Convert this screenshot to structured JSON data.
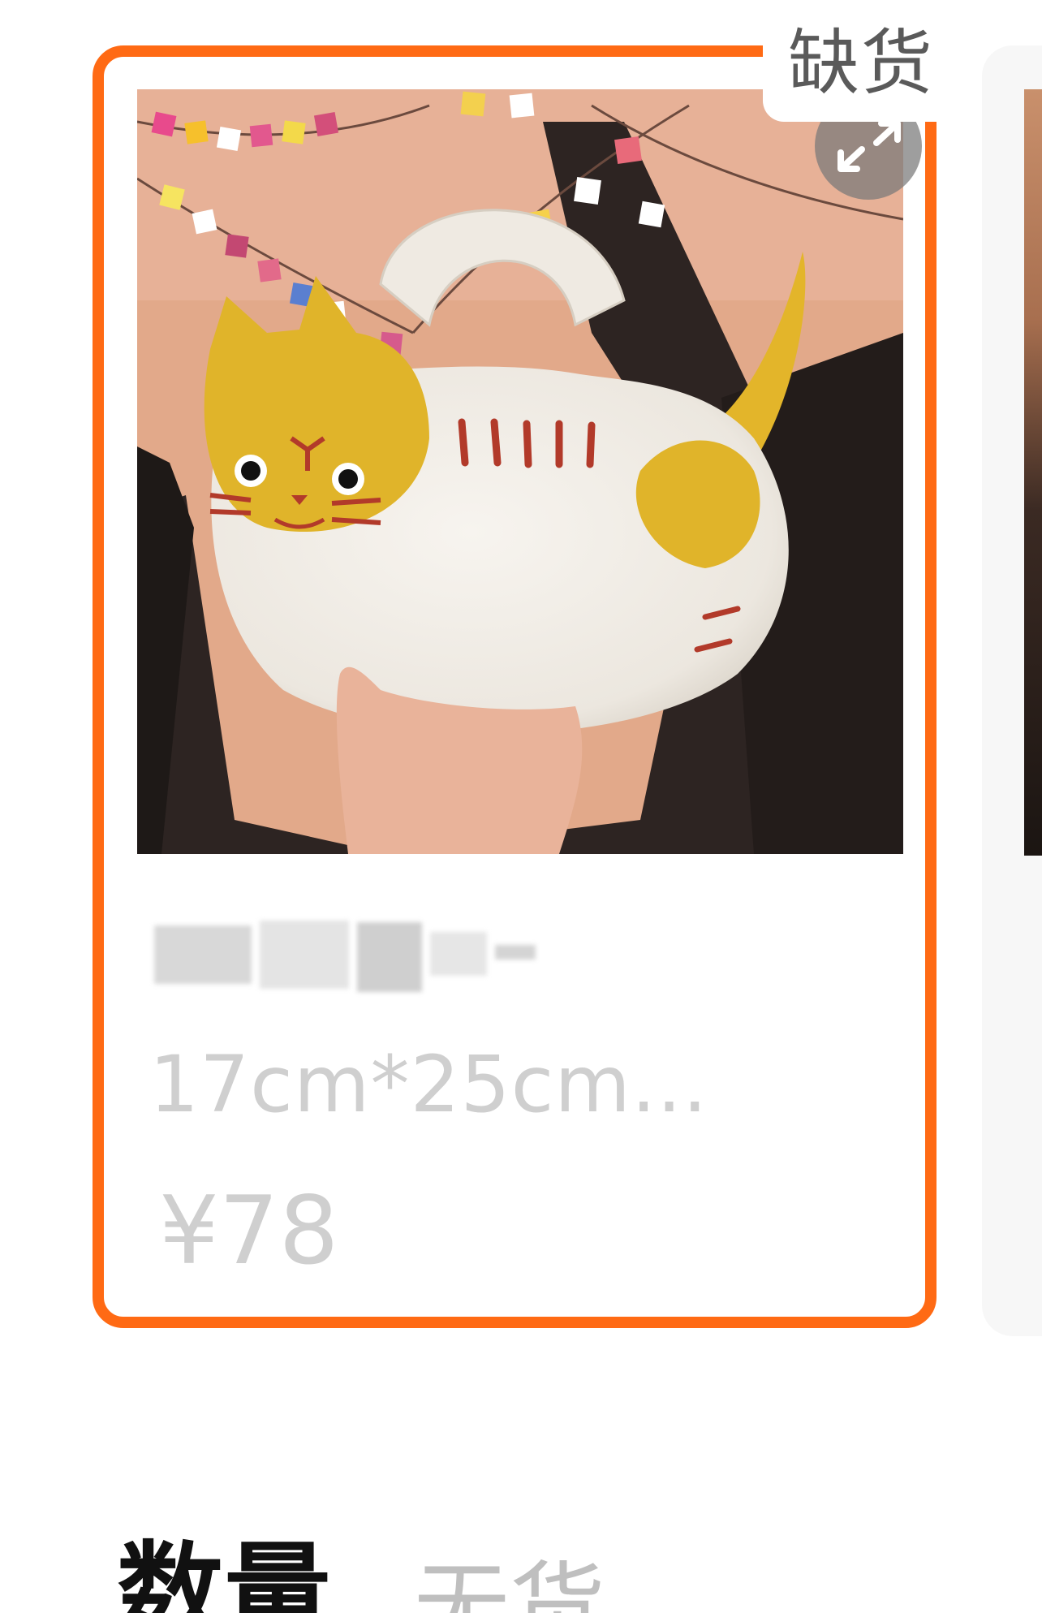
{
  "colors": {
    "selected_border": "#ff6a14",
    "muted_text": "#cfcfcf",
    "tag_text": "#5a5a5a",
    "label_text": "#111111"
  },
  "product_card": {
    "stock_tag": "缺货",
    "expand_icon": "expand-arrows-icon",
    "image": "felt-cat-handbag-photo",
    "name_blurred": true,
    "spec": "17cm*25cm...",
    "price": "¥78"
  },
  "quantity": {
    "label": "数量",
    "status": "无货"
  }
}
